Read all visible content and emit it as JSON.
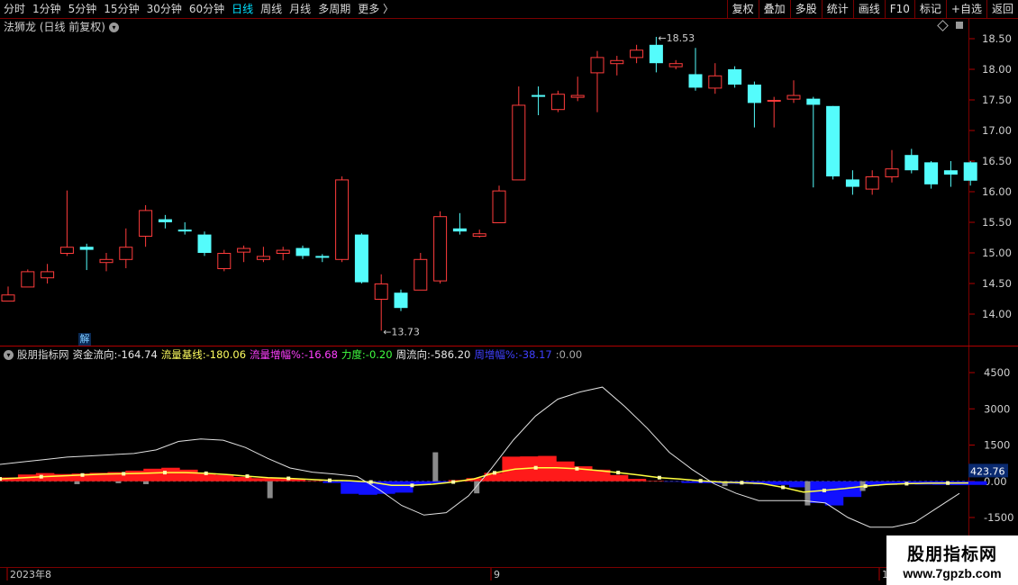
{
  "toolbar": {
    "periods": [
      "分时",
      "1分钟",
      "5分钟",
      "15分钟",
      "30分钟",
      "60分钟",
      "日线",
      "周线",
      "月线",
      "多周期",
      "更多 〉"
    ],
    "active": "日线",
    "buttons": [
      "复权",
      "叠加",
      "多股",
      "统计",
      "画线",
      "F10",
      "标记",
      "+自选",
      "返回"
    ]
  },
  "main": {
    "title": "法狮龙 (日线 前复权)",
    "high_label": "18.53",
    "low_label": "13.73",
    "y_ticks": [
      "18.50",
      "18.00",
      "17.50",
      "17.00",
      "16.50",
      "16.00",
      "15.50",
      "15.00",
      "14.50",
      "14.00"
    ]
  },
  "indicator": {
    "name": "股朋指标网",
    "fields": [
      {
        "label": "资金流向:",
        "value": "-164.74",
        "color": "#e8e8e8"
      },
      {
        "label": "流量基线:",
        "value": "-180.06",
        "color": "#ffff60"
      },
      {
        "label": "流量增幅%:",
        "value": "-16.68",
        "color": "#ff40ff"
      },
      {
        "label": "力度:",
        "value": "-0.20",
        "color": "#40ff40"
      },
      {
        "label": "周流向:",
        "value": "-586.20",
        "color": "#e8e8e8"
      },
      {
        "label": "周增幅%:",
        "value": "-38.17",
        "color": "#4040ff"
      },
      {
        "label": ":",
        "value": "0.00",
        "color": "#aaaaaa"
      }
    ],
    "y_ticks": [
      "4500",
      "3000",
      "1500",
      "0.00",
      "-1500"
    ],
    "current_value": "423.76"
  },
  "date_axis": [
    "2023年8",
    "9",
    "1"
  ],
  "jie_label": "解",
  "watermark": {
    "line1": "股朋指标网",
    "line2": "www.7gpzb.com"
  },
  "colors": {
    "up": "#ff3c3c",
    "down": "#54fcfc",
    "background": "#000000",
    "grid": "#7a0000"
  },
  "chart_data": {
    "type": "candlestick",
    "title": "法狮龙 (日线 前复权)",
    "ylim": [
      13.5,
      18.8
    ],
    "candles": [
      {
        "o": 14.22,
        "h": 14.45,
        "c": 14.32,
        "l": 14.22
      },
      {
        "o": 14.45,
        "h": 14.73,
        "c": 14.7,
        "l": 14.45
      },
      {
        "o": 14.6,
        "h": 14.82,
        "c": 14.7,
        "l": 14.5
      },
      {
        "o": 15.0,
        "h": 16.02,
        "c": 15.1,
        "l": 14.95
      },
      {
        "o": 15.1,
        "h": 15.15,
        "c": 15.05,
        "l": 14.72
      },
      {
        "o": 14.85,
        "h": 15.0,
        "c": 14.9,
        "l": 14.7
      },
      {
        "o": 14.9,
        "h": 15.4,
        "c": 15.1,
        "l": 14.75
      },
      {
        "o": 15.28,
        "h": 15.78,
        "c": 15.7,
        "l": 15.1
      },
      {
        "o": 15.55,
        "h": 15.62,
        "c": 15.5,
        "l": 15.4
      },
      {
        "o": 15.38,
        "h": 15.5,
        "c": 15.35,
        "l": 15.3
      },
      {
        "o": 15.3,
        "h": 15.35,
        "c": 15.0,
        "l": 14.95
      },
      {
        "o": 14.75,
        "h": 15.05,
        "c": 15.0,
        "l": 14.7
      },
      {
        "o": 15.02,
        "h": 15.12,
        "c": 15.08,
        "l": 14.85
      },
      {
        "o": 14.9,
        "h": 15.1,
        "c": 14.95,
        "l": 14.85
      },
      {
        "o": 15.0,
        "h": 15.1,
        "c": 15.05,
        "l": 14.88
      },
      {
        "o": 15.08,
        "h": 15.12,
        "c": 14.95,
        "l": 14.9
      },
      {
        "o": 14.95,
        "h": 14.98,
        "c": 14.92,
        "l": 14.85
      },
      {
        "o": 14.9,
        "h": 16.25,
        "c": 16.2,
        "l": 14.85
      },
      {
        "o": 15.3,
        "h": 15.32,
        "c": 14.52,
        "l": 14.5
      },
      {
        "o": 14.25,
        "h": 14.65,
        "c": 14.5,
        "l": 13.73
      },
      {
        "o": 14.35,
        "h": 14.4,
        "c": 14.1,
        "l": 14.05
      },
      {
        "o": 14.4,
        "h": 15.0,
        "c": 14.9,
        "l": 14.4
      },
      {
        "o": 14.55,
        "h": 15.68,
        "c": 15.6,
        "l": 14.5
      },
      {
        "o": 15.4,
        "h": 15.65,
        "c": 15.35,
        "l": 15.3
      },
      {
        "o": 15.28,
        "h": 15.38,
        "c": 15.32,
        "l": 15.25
      },
      {
        "o": 15.5,
        "h": 16.1,
        "c": 16.02,
        "l": 15.5
      },
      {
        "o": 16.2,
        "h": 17.72,
        "c": 17.42,
        "l": 16.2
      },
      {
        "o": 17.58,
        "h": 17.72,
        "c": 17.55,
        "l": 17.25
      },
      {
        "o": 17.35,
        "h": 17.65,
        "c": 17.6,
        "l": 17.3
      },
      {
        "o": 17.55,
        "h": 17.88,
        "c": 17.58,
        "l": 17.48
      },
      {
        "o": 17.95,
        "h": 18.3,
        "c": 18.2,
        "l": 17.3
      },
      {
        "o": 18.1,
        "h": 18.22,
        "c": 18.15,
        "l": 17.9
      },
      {
        "o": 18.2,
        "h": 18.4,
        "c": 18.32,
        "l": 18.1
      },
      {
        "o": 18.4,
        "h": 18.53,
        "c": 18.1,
        "l": 17.95
      },
      {
        "o": 18.05,
        "h": 18.15,
        "c": 18.1,
        "l": 18.0
      },
      {
        "o": 17.92,
        "h": 18.35,
        "c": 17.7,
        "l": 17.65
      },
      {
        "o": 17.7,
        "h": 18.1,
        "c": 17.9,
        "l": 17.6
      },
      {
        "o": 18.0,
        "h": 18.05,
        "c": 17.75,
        "l": 17.7
      },
      {
        "o": 17.75,
        "h": 17.8,
        "c": 17.45,
        "l": 17.05
      },
      {
        "o": 17.5,
        "h": 17.55,
        "c": 17.5,
        "l": 17.05
      },
      {
        "o": 17.52,
        "h": 17.82,
        "c": 17.58,
        "l": 17.45
      },
      {
        "o": 17.52,
        "h": 17.55,
        "c": 17.42,
        "l": 16.07
      },
      {
        "o": 17.4,
        "h": 17.4,
        "c": 16.25,
        "l": 16.2
      },
      {
        "o": 16.2,
        "h": 16.35,
        "c": 16.08,
        "l": 15.95
      },
      {
        "o": 16.05,
        "h": 16.35,
        "c": 16.25,
        "l": 15.95
      },
      {
        "o": 16.25,
        "h": 16.68,
        "c": 16.38,
        "l": 16.15
      },
      {
        "o": 16.6,
        "h": 16.7,
        "c": 16.35,
        "l": 16.3
      },
      {
        "o": 16.48,
        "h": 16.5,
        "c": 16.12,
        "l": 16.05
      },
      {
        "o": 16.35,
        "h": 16.5,
        "c": 16.28,
        "l": 16.08
      },
      {
        "o": 16.48,
        "h": 16.5,
        "c": 16.18,
        "l": 16.1
      }
    ]
  },
  "indicator_data": {
    "ylim": [
      -2500,
      5500
    ],
    "white_line": [
      700,
      800,
      900,
      1000,
      1050,
      1100,
      1150,
      1300,
      1650,
      1750,
      1700,
      1400,
      950,
      550,
      380,
      300,
      200,
      -350,
      -1000,
      -1400,
      -1300,
      -600,
      500,
      1700,
      2700,
      3400,
      3700,
      3900,
      3100,
      2200,
      1200,
      500,
      -100,
      -500,
      -800,
      -800,
      -800,
      -900,
      -1500,
      -1900,
      -1900,
      -1700,
      -1100,
      -500
    ],
    "yellow_line": [
      100,
      140,
      190,
      220,
      260,
      300,
      310,
      330,
      360,
      360,
      330,
      280,
      210,
      150,
      120,
      80,
      40,
      20,
      -30,
      -170,
      -170,
      -120,
      -30,
      100,
      350,
      500,
      560,
      560,
      520,
      450,
      360,
      260,
      150,
      90,
      20,
      -30,
      -60,
      -100,
      -250,
      -450,
      -380,
      -300,
      -200,
      -130,
      -100,
      -80,
      -75,
      -70
    ],
    "histogram": [
      160,
      280,
      340,
      300,
      320,
      350,
      380,
      440,
      520,
      560,
      480,
      330,
      260,
      180,
      130,
      130,
      100,
      20,
      -70,
      -520,
      -560,
      -520,
      -470,
      -160,
      -80,
      50,
      130,
      350,
      1020,
      1030,
      1050,
      820,
      620,
      480,
      260,
      100,
      20,
      -20,
      -70,
      -80,
      -100,
      -110,
      -130,
      -150,
      -250,
      -900,
      -1000,
      -650,
      -200,
      -150,
      -130,
      -140,
      -150,
      -160,
      -150
    ],
    "bars": [
      0,
      0,
      0,
      0,
      0,
      -120,
      0,
      0,
      -80,
      0,
      -120,
      0,
      0,
      0,
      0,
      0,
      0,
      0,
      0,
      -700,
      0,
      0,
      0,
      0,
      0,
      0,
      0,
      0,
      0,
      0,
      0,
      1200,
      0,
      0,
      -500,
      0,
      0,
      0,
      0,
      0,
      0,
      0,
      0,
      0,
      0,
      0,
      0,
      0,
      0,
      0,
      0,
      0,
      -200,
      0,
      0,
      0,
      0,
      0,
      -1000,
      0,
      0,
      0,
      -400,
      0,
      0,
      0,
      0,
      0,
      0,
      0,
      0
    ]
  }
}
